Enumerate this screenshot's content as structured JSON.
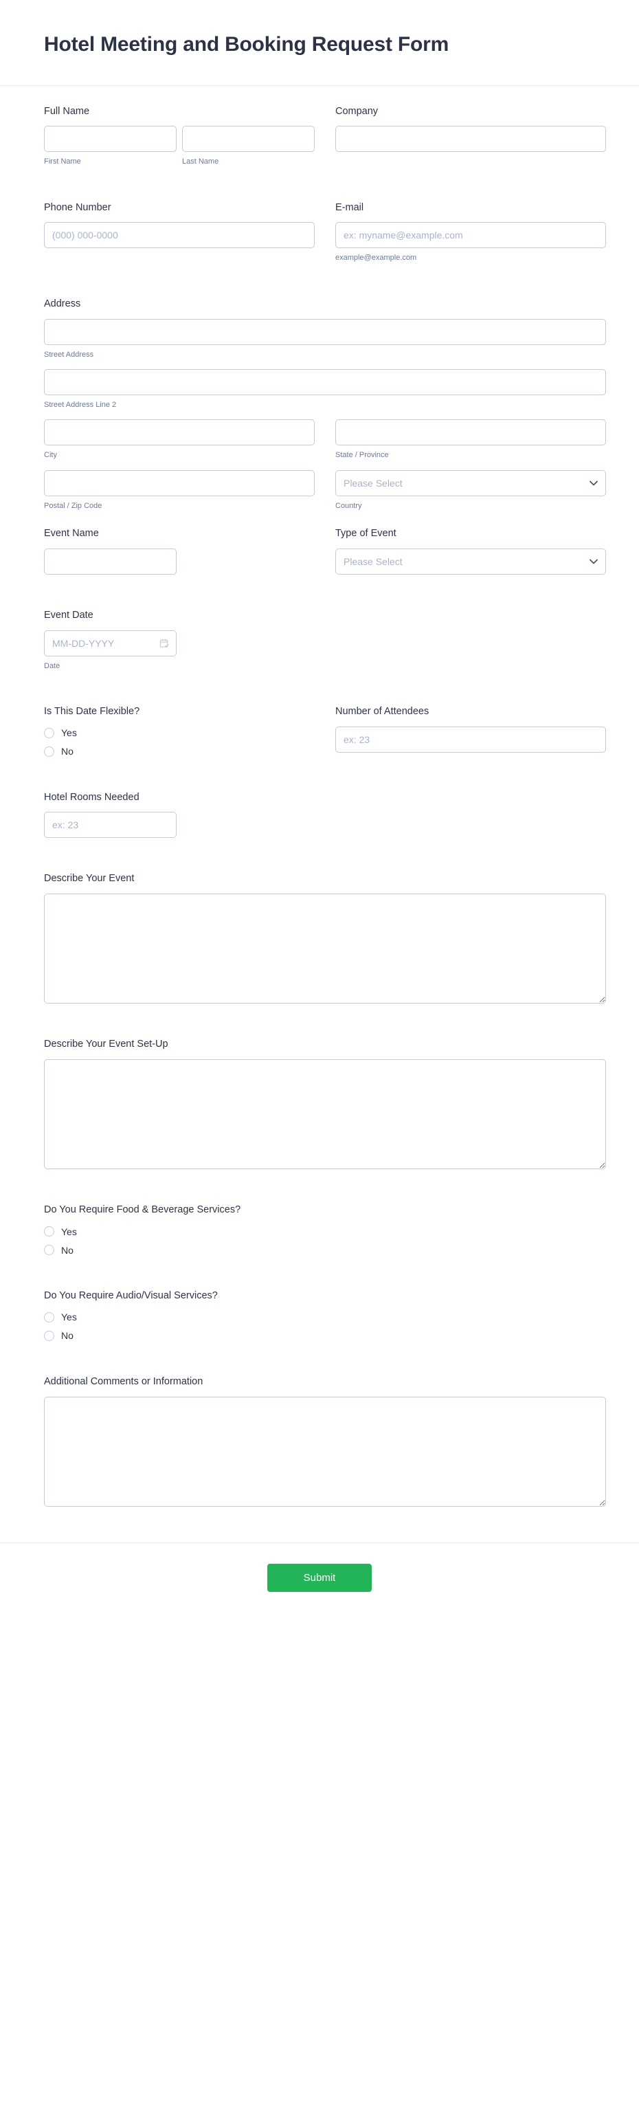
{
  "header": {
    "title": "Hotel Meeting and Booking Request Form"
  },
  "fields": {
    "full_name": {
      "label": "Full Name",
      "first_sublabel": "First Name",
      "last_sublabel": "Last Name",
      "first_value": "",
      "last_value": "",
      "first_placeholder": "",
      "last_placeholder": ""
    },
    "company": {
      "label": "Company",
      "value": "",
      "placeholder": ""
    },
    "phone": {
      "label": "Phone Number",
      "value": "",
      "placeholder": "(000) 000-0000"
    },
    "email": {
      "label": "E-mail",
      "value": "",
      "placeholder": "ex: myname@example.com",
      "hint": "example@example.com"
    },
    "address": {
      "label": "Address",
      "street_sublabel": "Street Address",
      "street2_sublabel": "Street Address Line 2",
      "city_sublabel": "City",
      "state_sublabel": "State / Province",
      "postal_sublabel": "Postal / Zip Code",
      "country_sublabel": "Country",
      "street_value": "",
      "street2_value": "",
      "city_value": "",
      "state_value": "",
      "postal_value": "",
      "country_selected": "Please Select",
      "country_options": [
        "Please Select"
      ]
    },
    "event_name": {
      "label": "Event Name",
      "value": "",
      "placeholder": ""
    },
    "event_type": {
      "label": "Type of Event",
      "selected": "Please Select",
      "options": [
        "Please Select"
      ]
    },
    "event_date": {
      "label": "Event Date",
      "value": "",
      "placeholder": "MM-DD-YYYY",
      "sublabel": "Date"
    },
    "date_flexible": {
      "label": "Is This Date Flexible?",
      "options": [
        "Yes",
        "No"
      ]
    },
    "attendees": {
      "label": "Number of Attendees",
      "value": "",
      "placeholder": "ex: 23"
    },
    "hotel_rooms": {
      "label": "Hotel Rooms Needed",
      "value": "",
      "placeholder": "ex: 23"
    },
    "describe_event": {
      "label": "Describe Your Event",
      "value": "",
      "placeholder": ""
    },
    "describe_setup": {
      "label": "Describe Your Event Set-Up",
      "value": "",
      "placeholder": ""
    },
    "food_beverage": {
      "label": "Do You Require Food & Beverage Services?",
      "options": [
        "Yes",
        "No"
      ]
    },
    "audio_visual": {
      "label": "Do You Require Audio/Visual Services?",
      "options": [
        "Yes",
        "No"
      ]
    },
    "additional_comments": {
      "label": "Additional Comments or Information",
      "value": "",
      "placeholder": ""
    }
  },
  "footer": {
    "submit_label": "Submit"
  },
  "icons": {
    "chevron_down": "chevron-down-icon",
    "calendar": "calendar-icon"
  },
  "colors": {
    "title": "#2c3345",
    "label": "#2c3345",
    "sublabel": "#6c7a96",
    "placeholder": "#a9b4c8",
    "border": "#c5cad6",
    "divider": "#e6e6f0",
    "submit_bg": "#22b457",
    "submit_text": "#ffffff"
  }
}
